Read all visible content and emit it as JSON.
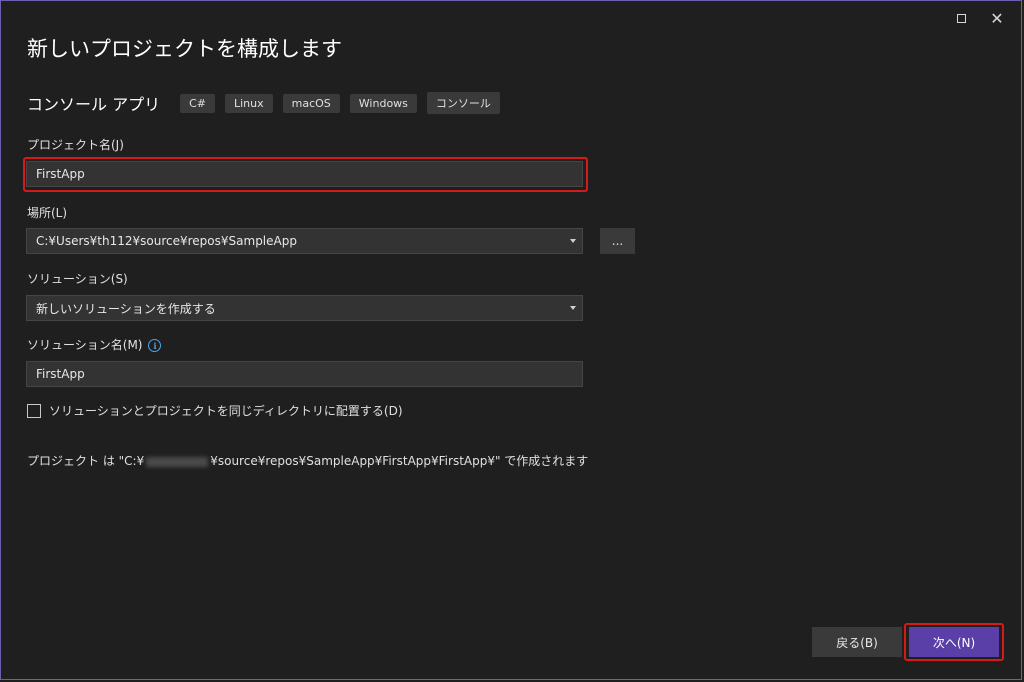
{
  "window": {
    "title": "新しいプロジェクトを構成します",
    "maximize_icon": "maximize-icon",
    "close_glyph": "✕"
  },
  "template": {
    "name": "コンソール アプリ",
    "tags": [
      "C#",
      "Linux",
      "macOS",
      "Windows",
      "コンソール"
    ]
  },
  "form": {
    "project_name_label": "プロジェクト名(J)",
    "project_name_value": "FirstApp",
    "location_label": "場所(L)",
    "location_value": "C:¥Users¥th112¥source¥repos¥SampleApp",
    "browse_label": "...",
    "solution_label": "ソリューション(S)",
    "solution_value": "新しいソリューションを作成する",
    "solution_name_label": "ソリューション名(M)",
    "solution_name_value": "FirstApp",
    "same_directory_label": "ソリューションとプロジェクトを同じディレクトリに配置する(D)",
    "same_directory_checked": false
  },
  "summary": {
    "prefix": "プロジェクト は \"C:¥",
    "suffix": "¥source¥repos¥SampleApp¥FirstApp¥FirstApp¥\" で作成されます"
  },
  "buttons": {
    "back_label": "戻る(B)",
    "next_label": "次へ(N)"
  },
  "colors": {
    "background": "#1f1f1f",
    "accent": "#5b3fa8",
    "highlight": "#d41b1b",
    "info": "#4aa8e8"
  }
}
